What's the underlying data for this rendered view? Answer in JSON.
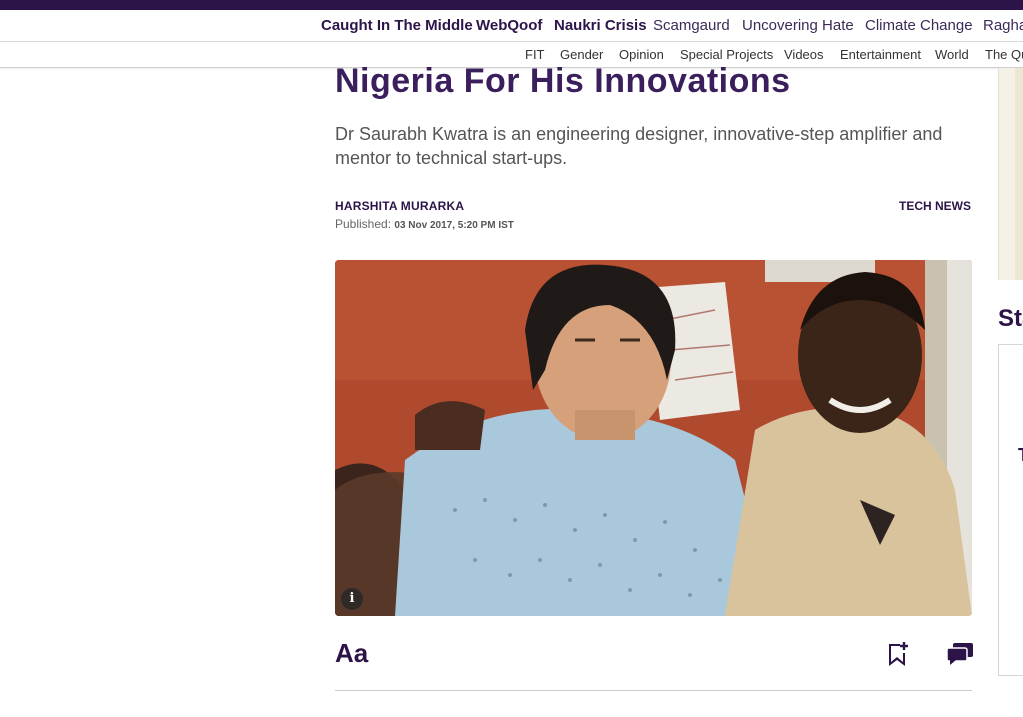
{
  "nav_primary": {
    "items": [
      {
        "label": "Caught In The Middle",
        "bold": true
      },
      {
        "label": "WebQoof",
        "bold": true
      },
      {
        "label": "Naukri Crisis",
        "bold": true
      },
      {
        "label": "Scamgaurd",
        "bold": false
      },
      {
        "label": "Uncovering Hate",
        "bold": false
      },
      {
        "label": "Climate Change",
        "bold": false
      },
      {
        "label": "Ragha",
        "bold": false
      }
    ]
  },
  "nav_secondary": {
    "items": [
      "FIT",
      "Gender",
      "Opinion",
      "Special Projects",
      "Videos",
      "Entertainment",
      "World",
      "The Qu"
    ]
  },
  "article": {
    "headline": "Nigeria For His Innovations",
    "dek": "Dr Saurabh Kwatra is an engineering designer, innovative-step amplifier and mentor to technical start-ups.",
    "author": "HARSHITA MURARKA",
    "published_label": "Published:",
    "published_date": "03 Nov 2017, 5:20 PM IST",
    "category": "TECH NEWS",
    "info_label": "i",
    "font_toggle_label": "Aa"
  },
  "rail": {
    "heading": "Sta",
    "card_mark": "T"
  },
  "colors": {
    "brand": "#2c1448",
    "headline": "#3a1f5c"
  },
  "icons": [
    "bookmark-add-icon",
    "comments-icon",
    "info-icon"
  ]
}
